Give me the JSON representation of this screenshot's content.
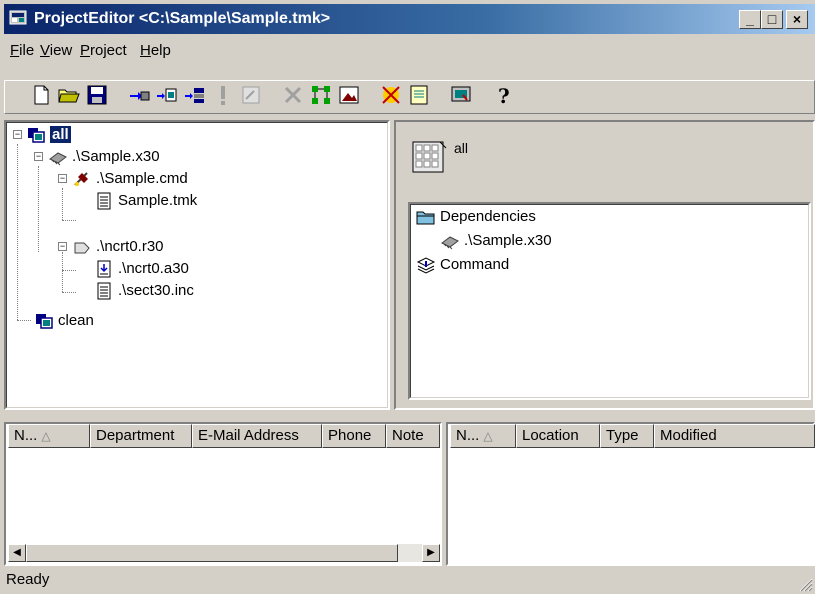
{
  "window": {
    "title": "ProjectEditor <C:\\Sample\\Sample.tmk>",
    "controls": {
      "minimize": "_",
      "maximize": "□",
      "close": "×"
    }
  },
  "menu": {
    "items": [
      {
        "label": "File",
        "accel": "F"
      },
      {
        "label": "View",
        "accel": "V"
      },
      {
        "label": "Project",
        "accel": "P"
      },
      {
        "label": "Help",
        "accel": "H"
      }
    ]
  },
  "toolbar": {
    "buttons": [
      "new-icon",
      "open-folder-icon",
      "save-icon",
      "build-icon",
      "rebuild-icon",
      "make-all-icon",
      "exclaim-icon",
      "properties-icon",
      "delete-icon",
      "tree-icon",
      "image-icon",
      "wizard-icon",
      "notepad-icon",
      "screen-icon",
      "help-icon"
    ]
  },
  "tree": {
    "nodes": [
      {
        "label": "all",
        "icon": "target-icon",
        "selected": true
      },
      {
        "label": ".\\Sample.x30",
        "icon": "chip-icon"
      },
      {
        "label": ".\\Sample.cmd",
        "icon": "command-icon"
      },
      {
        "label": "Sample.tmk",
        "icon": "document-icon"
      },
      {
        "label": ".\\ncrt0.r30",
        "icon": "object-icon"
      },
      {
        "label": ".\\ncrt0.a30",
        "icon": "asm-file-icon"
      },
      {
        "label": ".\\sect30.inc",
        "icon": "document-icon"
      },
      {
        "label": "clean",
        "icon": "target-icon"
      }
    ]
  },
  "detail": {
    "title": "all",
    "items": [
      {
        "label": "Dependencies",
        "icon": "folder-icon"
      },
      {
        "label": ".\\Sample.x30",
        "icon": "chip-icon"
      },
      {
        "label": "Command",
        "icon": "stack-icon"
      }
    ]
  },
  "left_list": {
    "columns": [
      "N...",
      "Department",
      "E-Mail Address",
      "Phone",
      "Note"
    ]
  },
  "right_list": {
    "columns": [
      "N...",
      "Location",
      "Type",
      "Modified"
    ]
  },
  "status": {
    "text": "Ready"
  }
}
